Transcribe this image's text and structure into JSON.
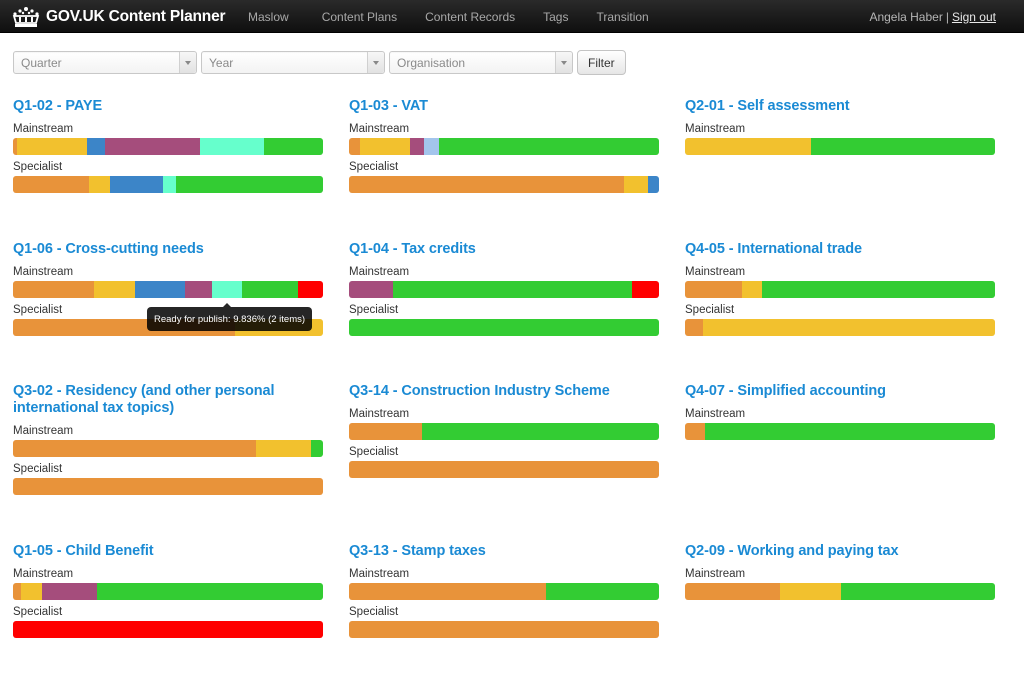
{
  "app": {
    "title": "GOV.UK Content Planner",
    "logo_icon": "crown-icon"
  },
  "nav": {
    "items": [
      {
        "label": "Maslow"
      },
      {
        "label": "Content Plans"
      },
      {
        "label": "Content Records"
      },
      {
        "label": "Tags"
      },
      {
        "label": "Transition"
      }
    ],
    "user_name": "Angela Haber",
    "separator": "|",
    "sign_out_label": "Sign out"
  },
  "filters": {
    "quarter_placeholder": "Quarter",
    "year_placeholder": "Year",
    "organisation_placeholder": "Organisation",
    "filter_button_label": "Filter"
  },
  "colors": {
    "orange": "#e8933a",
    "yellow": "#f2c12e",
    "blue": "#3c85c8",
    "purple": "#a54d7c",
    "aqua": "#66ffcc",
    "lightblue": "#a3c5ec",
    "green": "#33cc33",
    "red": "#ff0000",
    "title_blue": "#1a8ad4",
    "navbar_bg": "#1b1b1b"
  },
  "labels": {
    "mainstream": "Mainstream",
    "specialist": "Specialist"
  },
  "tooltip": {
    "text": "Ready for publish: 9.836% (2 items)"
  },
  "chart_data": {
    "type": "bar",
    "stacked": true,
    "orientation": "horizontal",
    "unit": "percent",
    "plans": [
      {
        "title": "Q1-02 - PAYE",
        "mainstream": [
          {
            "color": "orange",
            "pct": 1.3
          },
          {
            "color": "yellow",
            "pct": 22.6
          },
          {
            "color": "blue",
            "pct": 5.8
          },
          {
            "color": "purple",
            "pct": 30.6
          },
          {
            "color": "aqua",
            "pct": 20.6
          },
          {
            "color": "green",
            "pct": 19.1
          }
        ],
        "specialist": [
          {
            "color": "orange",
            "pct": 24.5
          },
          {
            "color": "yellow",
            "pct": 6.8
          },
          {
            "color": "blue",
            "pct": 17.1
          },
          {
            "color": "aqua",
            "pct": 4.2
          },
          {
            "color": "green",
            "pct": 47.4
          }
        ]
      },
      {
        "title": "Q1-03 - VAT",
        "mainstream": [
          {
            "color": "orange",
            "pct": 3.5
          },
          {
            "color": "yellow",
            "pct": 16.1
          },
          {
            "color": "purple",
            "pct": 4.5
          },
          {
            "color": "lightblue",
            "pct": 4.8
          },
          {
            "color": "green",
            "pct": 71.1
          }
        ],
        "specialist": [
          {
            "color": "orange",
            "pct": 88.7
          },
          {
            "color": "yellow",
            "pct": 7.7
          },
          {
            "color": "blue",
            "pct": 3.6
          }
        ]
      },
      {
        "title": "Q2-01 - Self assessment",
        "mainstream": [
          {
            "color": "yellow",
            "pct": 40.6
          },
          {
            "color": "green",
            "pct": 59.4
          }
        ],
        "specialist": null
      },
      {
        "title": "Q1-06 - Cross-cutting needs",
        "mainstream": [
          {
            "color": "orange",
            "pct": 26.2
          },
          {
            "color": "yellow",
            "pct": 13.2
          },
          {
            "color": "blue",
            "pct": 16.1
          },
          {
            "color": "purple",
            "pct": 8.7
          },
          {
            "color": "aqua",
            "pct": 9.836,
            "status": "Ready for publish",
            "items": 2
          },
          {
            "color": "green",
            "pct": 18.0
          },
          {
            "color": "red",
            "pct": 7.964
          }
        ],
        "specialist": [
          {
            "color": "orange",
            "pct": 71.6
          },
          {
            "color": "yellow",
            "pct": 28.4
          }
        ]
      },
      {
        "title": "Q1-04 - Tax credits",
        "mainstream": [
          {
            "color": "purple",
            "pct": 14.2
          },
          {
            "color": "green",
            "pct": 77.1
          },
          {
            "color": "red",
            "pct": 8.7
          }
        ],
        "specialist": [
          {
            "color": "green",
            "pct": 100
          }
        ]
      },
      {
        "title": "Q4-05 - International trade",
        "mainstream": [
          {
            "color": "orange",
            "pct": 18.4
          },
          {
            "color": "yellow",
            "pct": 6.5
          },
          {
            "color": "green",
            "pct": 75.1
          }
        ],
        "specialist": [
          {
            "color": "orange",
            "pct": 5.8
          },
          {
            "color": "yellow",
            "pct": 94.2
          }
        ]
      },
      {
        "title": "Q3-02 - Residency (and other personal international tax topics)",
        "mainstream": [
          {
            "color": "orange",
            "pct": 78.4
          },
          {
            "color": "yellow",
            "pct": 17.7
          },
          {
            "color": "green",
            "pct": 3.9
          }
        ],
        "specialist": [
          {
            "color": "orange",
            "pct": 100
          }
        ]
      },
      {
        "title": "Q3-14 - Construction Industry Scheme",
        "mainstream": [
          {
            "color": "orange",
            "pct": 23.5
          },
          {
            "color": "green",
            "pct": 76.5
          }
        ],
        "specialist": [
          {
            "color": "orange",
            "pct": 100
          }
        ]
      },
      {
        "title": "Q4-07 - Simplified accounting",
        "mainstream": [
          {
            "color": "orange",
            "pct": 6.5
          },
          {
            "color": "green",
            "pct": 93.5
          }
        ],
        "specialist": null
      },
      {
        "title": "Q1-05 - Child Benefit",
        "mainstream": [
          {
            "color": "orange",
            "pct": 2.6
          },
          {
            "color": "yellow",
            "pct": 6.8
          },
          {
            "color": "purple",
            "pct": 17.7
          },
          {
            "color": "green",
            "pct": 72.9
          }
        ],
        "specialist": [
          {
            "color": "red",
            "pct": 100
          }
        ]
      },
      {
        "title": "Q3-13 - Stamp taxes",
        "mainstream": [
          {
            "color": "orange",
            "pct": 63.5
          },
          {
            "color": "green",
            "pct": 36.5
          }
        ],
        "specialist": [
          {
            "color": "orange",
            "pct": 100
          }
        ]
      },
      {
        "title": "Q2-09 - Working and paying tax",
        "mainstream": [
          {
            "color": "orange",
            "pct": 30.6
          },
          {
            "color": "yellow",
            "pct": 19.7
          },
          {
            "color": "green",
            "pct": 49.7
          }
        ],
        "specialist": null
      }
    ]
  }
}
